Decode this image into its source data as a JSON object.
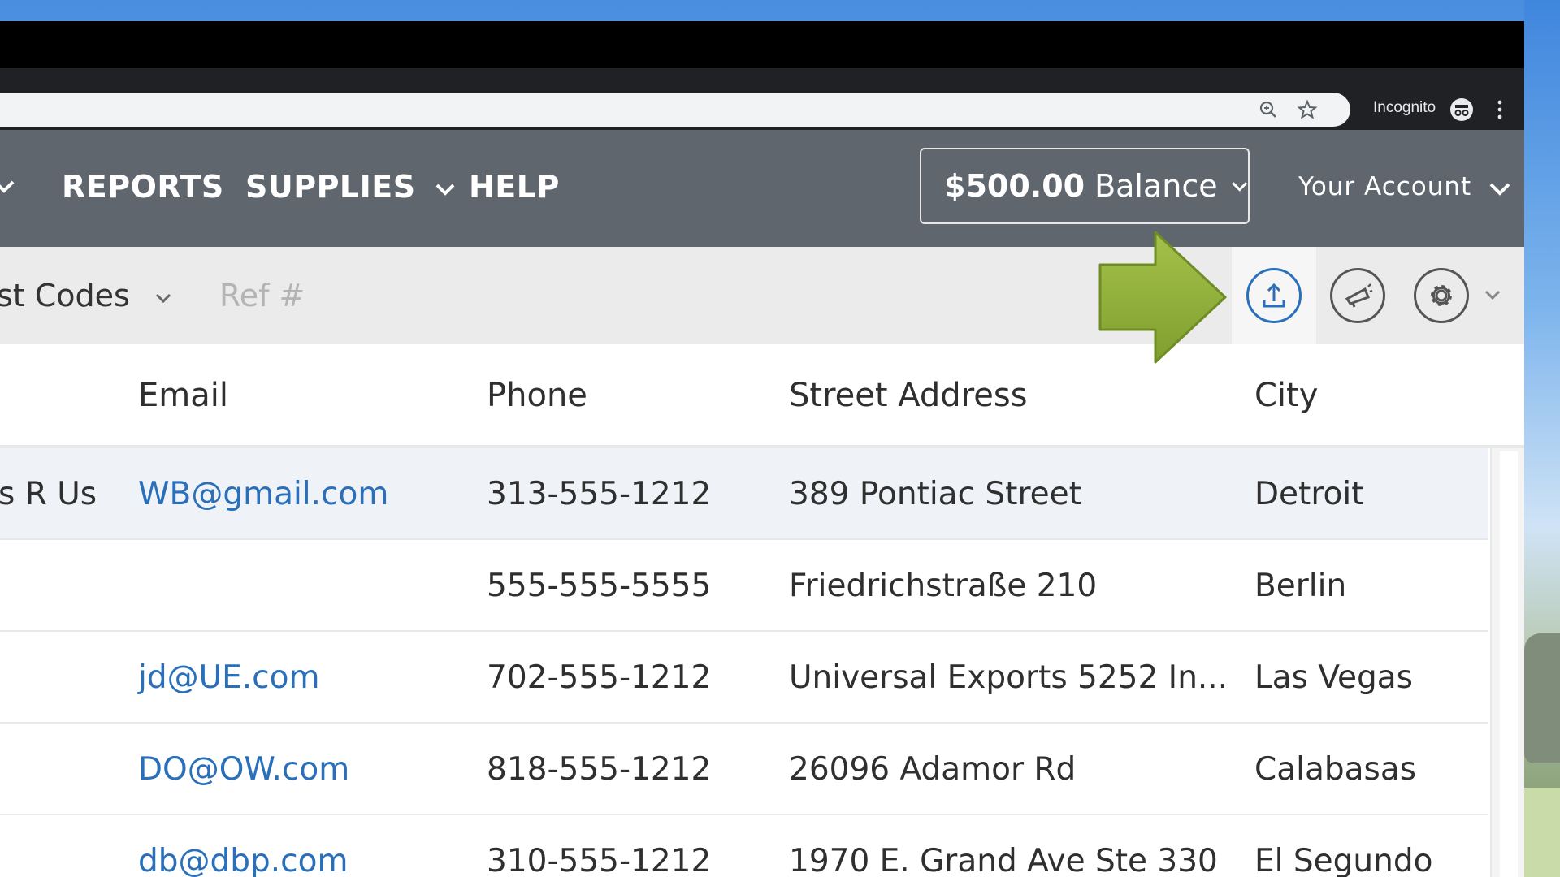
{
  "browser": {
    "incognito_label": "Incognito",
    "icons": [
      "zoom-icon",
      "bookmark-star-icon",
      "incognito-icon",
      "menu-dots-icon"
    ]
  },
  "nav": {
    "items": [
      {
        "label": "REPORTS",
        "has_dropdown": false
      },
      {
        "label": "SUPPLIES",
        "has_dropdown": true
      },
      {
        "label": "HELP",
        "has_dropdown": false
      }
    ],
    "balance_amount": "$500.00",
    "balance_label": "Balance",
    "account_label": "Your Account",
    "bar_color": "#5f666d"
  },
  "filters": {
    "codes_label": "st Codes",
    "ref_placeholder": "Ref #"
  },
  "toolbar_actions": [
    {
      "name": "upload-icon",
      "color": "#2a6fba",
      "highlighted": true
    },
    {
      "name": "megaphone-icon",
      "color": "#555555"
    },
    {
      "name": "gear-icon",
      "color": "#555555"
    }
  ],
  "callout": {
    "icon": "green-arrow-icon",
    "color": "#8fb03b"
  },
  "table": {
    "columns": [
      "Email",
      "Phone",
      "Street Address",
      "City"
    ],
    "rows": [
      {
        "company": "s R Us",
        "email": "WB@gmail.com",
        "phone": "313-555-1212",
        "street": "389 Pontiac Street",
        "city": "Detroit",
        "highlighted": true
      },
      {
        "company": "",
        "email": "",
        "phone": "555-555-5555",
        "street": "Friedrichstraße 210",
        "city": "Berlin"
      },
      {
        "company": "",
        "email": "jd@UE.com",
        "phone": "702-555-1212",
        "street": "Universal Exports 5252 In...",
        "city": "Las Vegas"
      },
      {
        "company": "",
        "email": "DO@OW.com",
        "phone": "818-555-1212",
        "street": "26096 Adamor Rd",
        "city": "Calabasas"
      },
      {
        "company": "",
        "email": "db@dbp.com",
        "phone": "310-555-1212",
        "street": "1970 E. Grand Ave Ste 330",
        "city": "El Segundo"
      }
    ],
    "link_color": "#2a6fba"
  }
}
